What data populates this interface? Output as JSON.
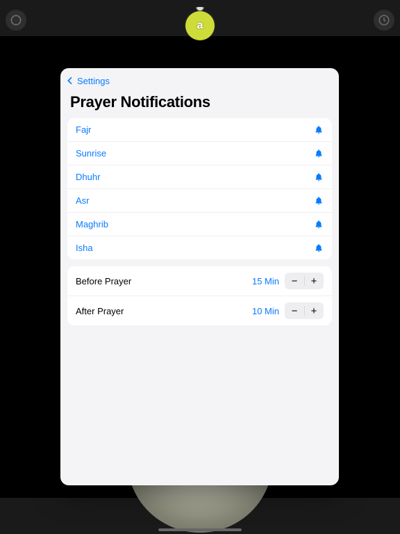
{
  "nav": {
    "back_label": "Settings"
  },
  "page": {
    "title": "Prayer Notifications"
  },
  "prayers": [
    {
      "name": "Fajr"
    },
    {
      "name": "Sunrise"
    },
    {
      "name": "Dhuhr"
    },
    {
      "name": "Asr"
    },
    {
      "name": "Maghrib"
    },
    {
      "name": "Isha"
    }
  ],
  "offsets": {
    "before": {
      "label": "Before Prayer",
      "value": "15 Min"
    },
    "after": {
      "label": "After Prayer",
      "value": "10 Min"
    }
  },
  "glyphs": {
    "minus": "−",
    "plus": "+"
  },
  "colors": {
    "accent": "#0a7aff",
    "badge": "#cddc39"
  }
}
